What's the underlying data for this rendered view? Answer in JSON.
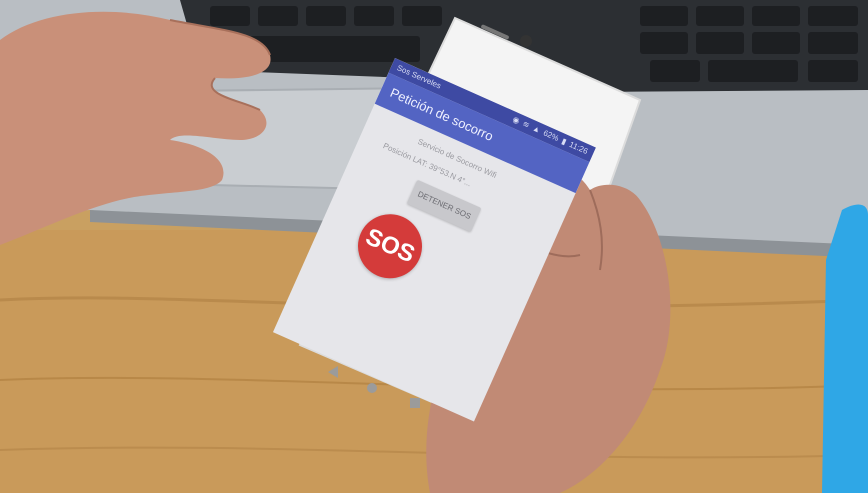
{
  "status": {
    "left_text": "Sos Serveles",
    "right_icons": [
      "location-icon",
      "wifi-icon",
      "signal-icon"
    ],
    "battery": "62%",
    "time": "11:26"
  },
  "app": {
    "title": "Petición de socorro"
  },
  "content": {
    "line1": "Servicio de Socorro Wifi",
    "line2": "Posición LAT: 39°53.N 4°...",
    "stop_button": "DETENER SOS",
    "sos_button": "SOS"
  },
  "colors": {
    "app_bar": "#5364c3",
    "status_bar": "#3e4aa3",
    "sos_red": "#d43b3a",
    "screen_bg": "#e6e6ea"
  }
}
